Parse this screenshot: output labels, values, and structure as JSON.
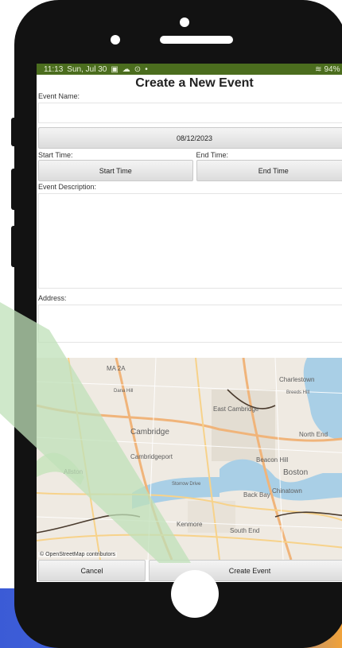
{
  "status": {
    "time": "11:13",
    "date": "Sun, Jul 30",
    "battery": "94%",
    "icons": [
      "image-icon",
      "cloud-icon",
      "sync-icon",
      "dot-icon"
    ]
  },
  "form": {
    "title": "Create a New Event",
    "event_name_label": "Event Name:",
    "event_name_value": "",
    "date_button": "08/12/2023",
    "start_time_label": "Start Time:",
    "end_time_label": "End Time:",
    "start_time_button": "Start Time",
    "end_time_button": "End Time",
    "description_label": "Event Description:",
    "description_value": "",
    "address_label": "Address:",
    "address_value": ""
  },
  "map": {
    "credit": "© OpenStreetMap contributors",
    "places": [
      "MA 2A",
      "Charlestown",
      "Breeds Hill",
      "East Cambridge",
      "Dana Hill",
      "Cambridge",
      "North End",
      "Cambridgeport",
      "Beacon Hill",
      "Boston",
      "Allston",
      "Storrow Drive",
      "Back Bay",
      "Chinatown",
      "Kenmore",
      "South End"
    ]
  },
  "actions": {
    "cancel": "Cancel",
    "create": "Create Event"
  }
}
